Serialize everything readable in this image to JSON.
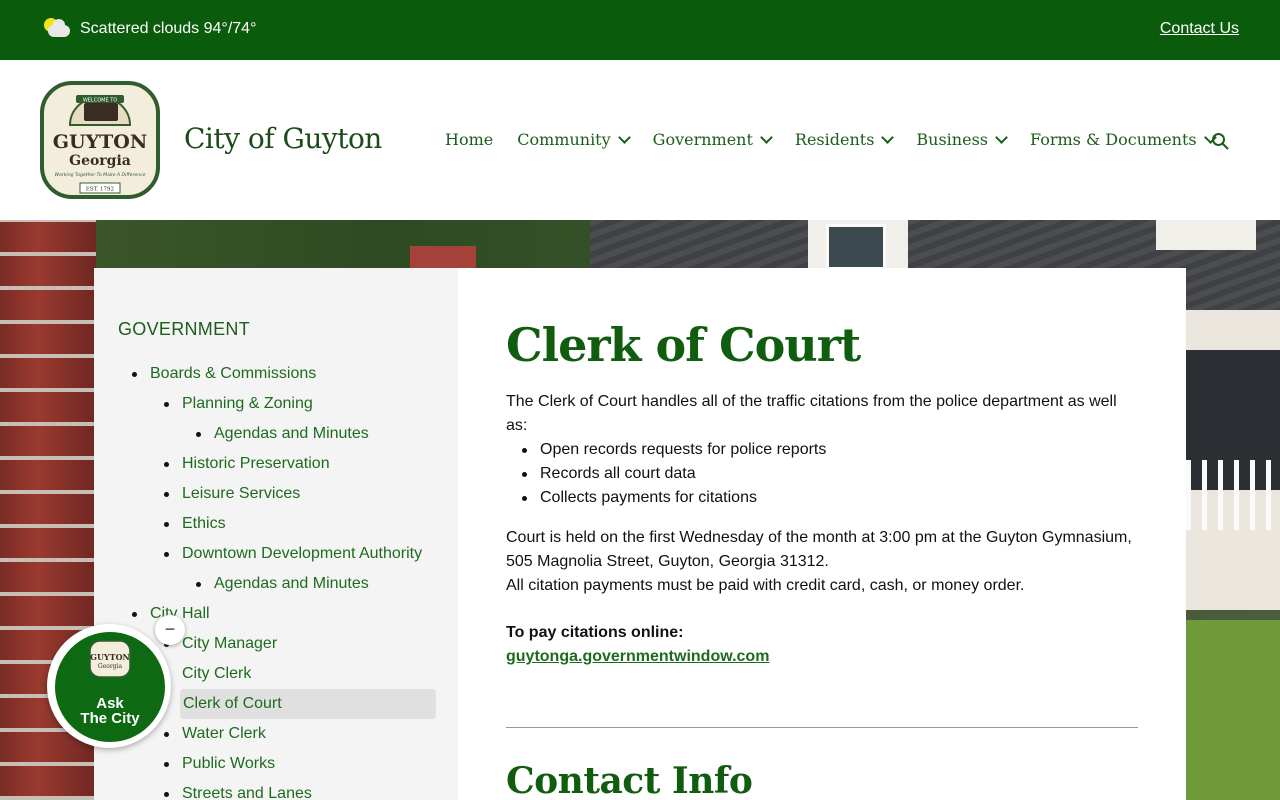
{
  "topbar": {
    "weather": "Scattered clouds 94°/74°",
    "contact_label": "Contact Us"
  },
  "header": {
    "logo": {
      "badge_top": "WELCOME TO",
      "name": "GUYTON",
      "state": "Georgia",
      "tagline": "Working Together To Make A Difference",
      "est": "EST. 1792"
    },
    "site_title": "City of Guyton",
    "nav": [
      {
        "label": "Home",
        "has_dropdown": false
      },
      {
        "label": "Community",
        "has_dropdown": true
      },
      {
        "label": "Government",
        "has_dropdown": true
      },
      {
        "label": "Residents",
        "has_dropdown": true
      },
      {
        "label": "Business",
        "has_dropdown": true
      },
      {
        "label": "Forms & Documents",
        "has_dropdown": true
      }
    ]
  },
  "sidebar": {
    "heading": "GOVERNMENT",
    "items": [
      {
        "label": "Boards & Commissions",
        "level": 1
      },
      {
        "label": "Planning & Zoning",
        "level": 2
      },
      {
        "label": "Agendas and Minutes",
        "level": 3
      },
      {
        "label": "Historic Preservation",
        "level": 2
      },
      {
        "label": "Leisure Services",
        "level": 2
      },
      {
        "label": "Ethics",
        "level": 2
      },
      {
        "label": "Downtown Development Authority",
        "level": 2
      },
      {
        "label": "Agendas and Minutes",
        "level": 3
      },
      {
        "label": "City Hall",
        "level": 1
      },
      {
        "label": "City Manager",
        "level": 2
      },
      {
        "label": "City Clerk",
        "level": 2
      },
      {
        "label": "Clerk of Court",
        "level": 2,
        "active": true
      },
      {
        "label": "Water Clerk",
        "level": 2
      },
      {
        "label": "Public Works",
        "level": 2
      },
      {
        "label": "Streets and Lanes",
        "level": 2
      }
    ]
  },
  "main": {
    "title": "Clerk of Court",
    "intro": "The Clerk of Court handles all of the traffic citations from the police department as well as:",
    "bullets": [
      "Open records requests for police reports",
      "Records all court data",
      "Collects payments for citations"
    ],
    "court_info_1": "Court is held on the first Wednesday of the month at 3:00 pm at the Guyton Gymnasium, 505 Magnolia Street, Guyton, Georgia 31312.",
    "court_info_2": "All citation payments must be paid with credit card, cash, or money order.",
    "pay_label": "To pay citations online:",
    "pay_link": "guytonga.governmentwindow.com",
    "contact_heading": "Contact Info"
  },
  "ask_widget": {
    "label_line1": "Ask",
    "label_line2": "The City",
    "mini_name": "GUYTON",
    "mini_state": "Georgia",
    "minimize": "−"
  },
  "colors": {
    "brand_green": "#0b5b0c",
    "link_green": "#1e6b1e",
    "sidebar_bg": "#f4f4f4",
    "active_bg": "#e0e0e0"
  }
}
